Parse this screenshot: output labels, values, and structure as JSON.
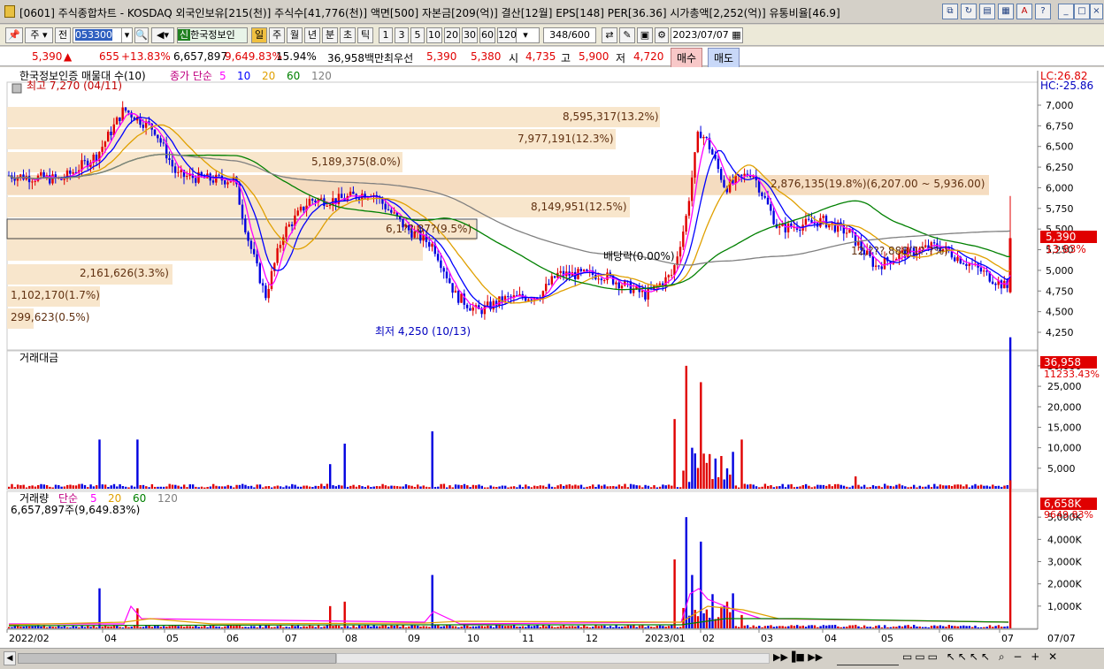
{
  "window": {
    "title": "[0601] 주식종합차트 - KOSDAQ 외국인보유[215(천)] 주식수[41,776(천)] 액면[500] 자본금[209(억)] 결산[12월] EPS[148] PER[36.36] 시가총액[2,252(억)] 유통비율[46.9]"
  },
  "toolbar": {
    "market": "주",
    "prev_label": "전",
    "code": "053300",
    "stock_name": "한국정보인",
    "period_buttons": [
      "일",
      "주",
      "월",
      "년",
      "분",
      "초",
      "틱"
    ],
    "ma_buttons": [
      "1",
      "3",
      "5",
      "10",
      "20",
      "30",
      "60",
      "120"
    ],
    "count": "348",
    "count_total": "/600",
    "date": "2023/07/07"
  },
  "quote": {
    "price": "5,390",
    "arrow": "▲",
    "change": "655",
    "change_pct": "+13.83%",
    "volume": "6,657,897",
    "volume_pct": "9,649.83%",
    "turnover": "15.94%",
    "amount": "36,958백만",
    "best_bid_label": "최우선",
    "ask": "5,390",
    "bid": "5,380",
    "open_label": "시",
    "open": "4,735",
    "high_label": "고",
    "high": "5,900",
    "low_label": "저",
    "low": "4,720",
    "buy": "매수",
    "sell": "매도"
  },
  "price_panel": {
    "legend_title": "한국정보인증 매물대 수(10)",
    "legend_ma": "종가 단순",
    "ma_periods": [
      "5",
      "10",
      "20",
      "60",
      "120"
    ],
    "lc": "LC:26.82",
    "hc": "HC:-25.86",
    "current_price": "5,390",
    "current_pct": "13.83%",
    "high_note": "최고 7,270 (04/11)",
    "low_note": "최저 4,250 (10/13)",
    "dividend_note": "배당락(0.00%)",
    "yticks": [
      "7,000",
      "6,750",
      "6,500",
      "6,250",
      "6,000",
      "5,750",
      "5,500",
      "5,250",
      "5,000",
      "4,750",
      "4,500",
      "4,250"
    ],
    "profile_labels": [
      "8,595,317(13.2%)",
      "7,977,191(12.3%)",
      "5,189,375(8.0%)",
      "8,149,951(12.5%)",
      "6,1??,87?(9.5%)",
      "2,161,626(3.3%)",
      "1,102,170(1.7%)",
      "299,623(0.5%)",
      "2,876,135(19.8%)(6,207.00 ~ 5,936.00)",
      "12,???,888(1?.?%)"
    ]
  },
  "amount_panel": {
    "title": "거래대금",
    "current": "36,958",
    "sub": "11233.43%",
    "yticks": [
      "30,000",
      "25,000",
      "20,000",
      "15,000",
      "10,000",
      "5,000"
    ]
  },
  "volume_panel": {
    "title": "거래량",
    "ma_label": "단순",
    "ma_periods": [
      "5",
      "20",
      "60",
      "120"
    ],
    "info": "6,657,897주(9,649.83%)",
    "current": "6,658K",
    "sub": "9649.83%",
    "yticks": [
      "5,000K",
      "4,000K",
      "3,000K",
      "2,000K",
      "1,000K"
    ]
  },
  "xaxis": {
    "labels": [
      "2022/02",
      "04",
      "05",
      "06",
      "07",
      "08",
      "09",
      "10",
      "11",
      "12",
      "2023/01",
      "02",
      "03",
      "04",
      "05",
      "06",
      "07"
    ],
    "right_label": "07/07"
  },
  "colors": {
    "up": "#e00000",
    "down": "#0000e0",
    "ma5": "#ff00ff",
    "ma10": "#0000ff",
    "ma20": "#e0a000",
    "ma60": "#008000",
    "ma120": "#808080",
    "profile": "#f8e6cc"
  }
}
